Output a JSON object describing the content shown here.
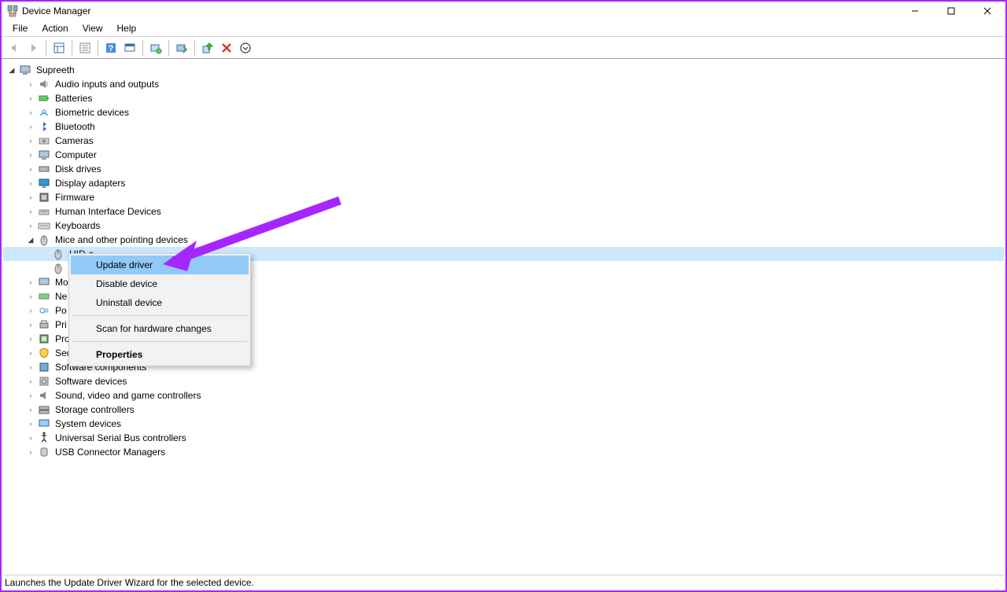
{
  "window": {
    "title": "Device Manager"
  },
  "menu": {
    "file": "File",
    "action": "Action",
    "view": "View",
    "help": "Help"
  },
  "tree": {
    "root": "Supreeth",
    "items": [
      "Audio inputs and outputs",
      "Batteries",
      "Biometric devices",
      "Bluetooth",
      "Cameras",
      "Computer",
      "Disk drives",
      "Display adapters",
      "Firmware",
      "Human Interface Devices",
      "Keyboards",
      "Mice and other pointing devices",
      "Mo",
      "Ne",
      "Po",
      "Pri",
      "Pro",
      "Sec",
      "Software components",
      "Software devices",
      "Sound, video and game controllers",
      "Storage controllers",
      "System devices",
      "Universal Serial Bus controllers",
      "USB Connector Managers"
    ],
    "mouse_device_selected": "HID-c"
  },
  "context": {
    "update": "Update driver",
    "disable": "Disable device",
    "uninstall": "Uninstall device",
    "scan": "Scan for hardware changes",
    "props": "Properties"
  },
  "status": "Launches the Update Driver Wizard for the selected device."
}
